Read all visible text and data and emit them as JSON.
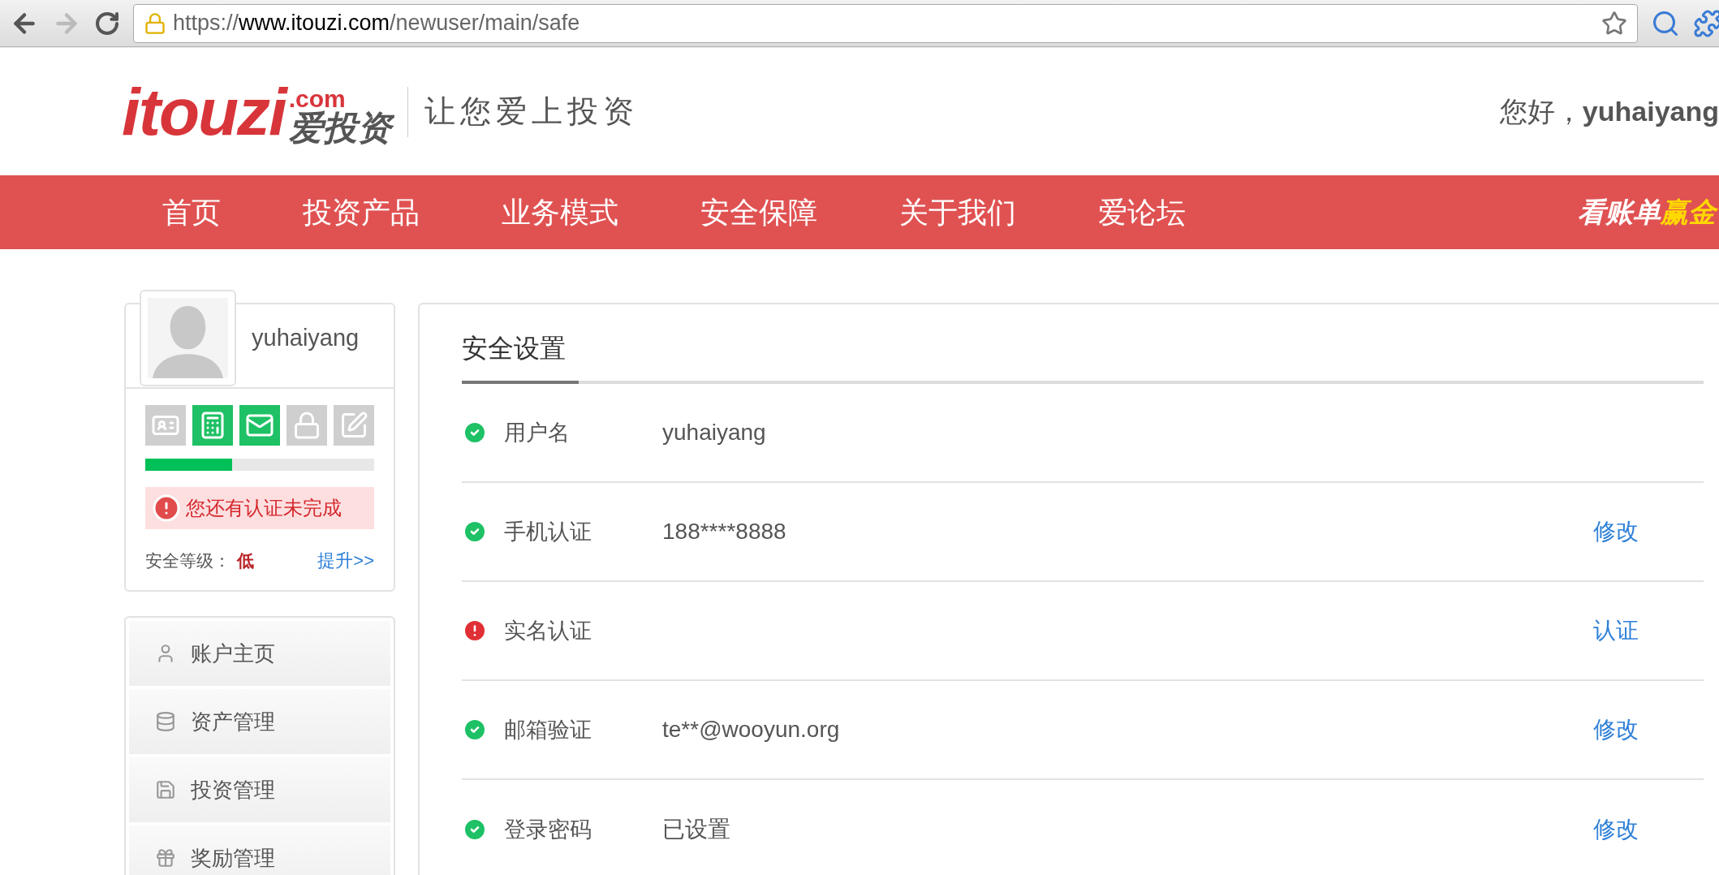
{
  "browser": {
    "url_scheme": "https://",
    "url_host": "www.itouzi.com",
    "url_path": "/newuser/main/safe",
    "forward_disabled": true
  },
  "header": {
    "logo_brand": "itouzi",
    "logo_domain": ".com",
    "logo_cn": "爱投资",
    "slogan": "让您爱上投资",
    "greeting": "您好，",
    "username": "yuhaiyang"
  },
  "nav": {
    "items": [
      {
        "label": "首页"
      },
      {
        "label": "投资产品"
      },
      {
        "label": "业务模式"
      },
      {
        "label": "安全保障"
      },
      {
        "label": "关于我们"
      },
      {
        "label": "爱论坛"
      }
    ],
    "promo_white": "看账单",
    "promo_yellow": "赢金"
  },
  "profile": {
    "username": "yuhaiyang",
    "badges": [
      {
        "kind": "identity",
        "done": false
      },
      {
        "kind": "phone",
        "done": true
      },
      {
        "kind": "email",
        "done": true
      },
      {
        "kind": "password",
        "done": false
      },
      {
        "kind": "profile",
        "done": false
      }
    ],
    "level": 0.38,
    "alert": "您还有认证未完成",
    "security_label": "安全等级：",
    "security_value": "低",
    "upgrade_link": "提升>>"
  },
  "sidebar": {
    "items": [
      {
        "kind": "account",
        "label": "账户主页"
      },
      {
        "kind": "assets",
        "label": "资产管理"
      },
      {
        "kind": "invest",
        "label": "投资管理"
      },
      {
        "kind": "reward",
        "label": "奖励管理"
      }
    ]
  },
  "panel": {
    "title": "安全设置",
    "rows": [
      {
        "verified": true,
        "label": "用户名",
        "value": "yuhaiyang"
      },
      {
        "verified": true,
        "label": "手机认证",
        "value": "188****8888",
        "action": "修改"
      },
      {
        "verified": false,
        "label": "实名认证",
        "action": "认证"
      },
      {
        "verified": true,
        "label": "邮箱验证",
        "value": "te**@wooyun.org",
        "action": "修改"
      },
      {
        "verified": true,
        "label": "登录密码",
        "value": "已设置",
        "action": "修改"
      }
    ]
  }
}
